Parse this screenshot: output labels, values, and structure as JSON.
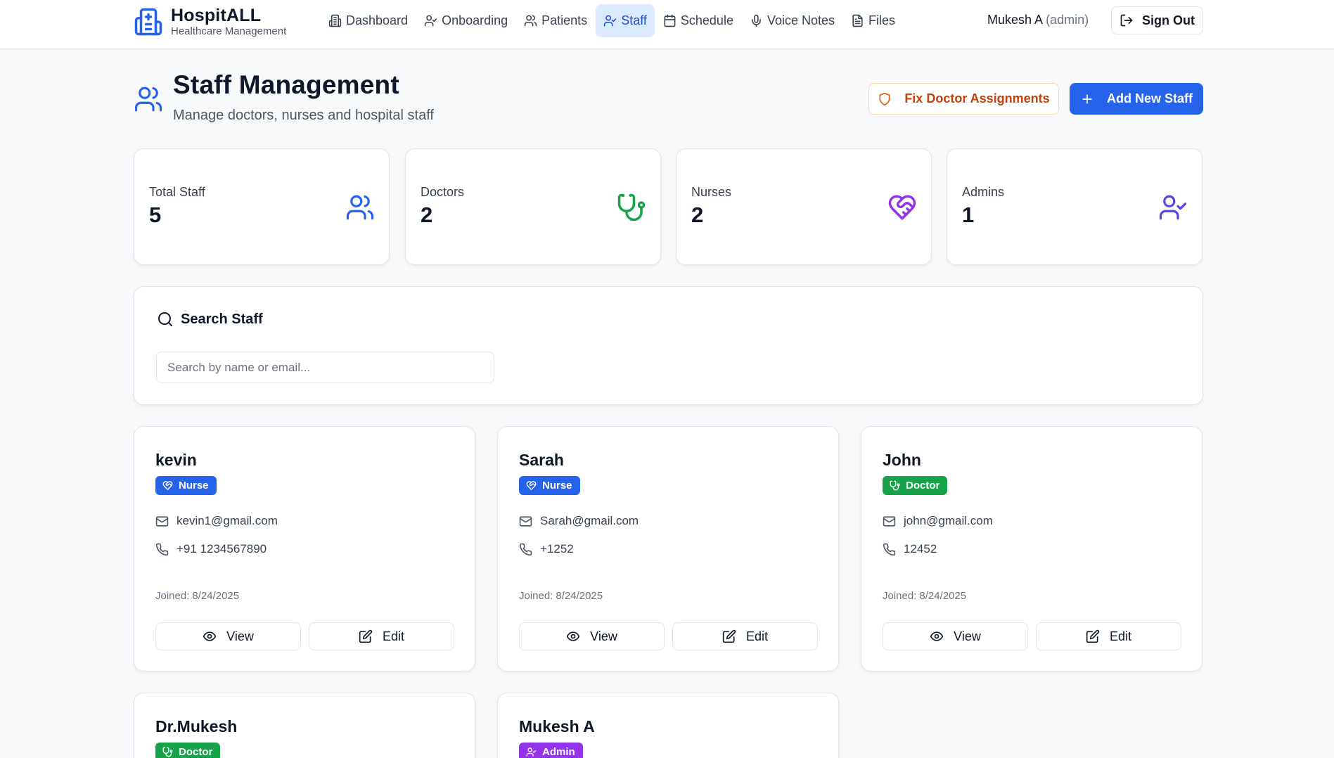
{
  "brand": {
    "title": "HospitALL",
    "subtitle": "Healthcare Management"
  },
  "nav": [
    {
      "label": "Dashboard",
      "icon": "building-icon"
    },
    {
      "label": "Onboarding",
      "icon": "user-check-icon"
    },
    {
      "label": "Patients",
      "icon": "users-icon"
    },
    {
      "label": "Staff",
      "icon": "user-check-icon",
      "active": true
    },
    {
      "label": "Schedule",
      "icon": "calendar-icon"
    },
    {
      "label": "Voice Notes",
      "icon": "mic-icon"
    },
    {
      "label": "Files",
      "icon": "file-icon"
    }
  ],
  "user": {
    "name": "Mukesh A",
    "role": "(admin)"
  },
  "signout_label": "Sign Out",
  "page": {
    "title": "Staff Management",
    "subtitle": "Manage doctors, nurses and hospital staff",
    "fix_label": "Fix Doctor Assignments",
    "add_label": "Add New Staff"
  },
  "stats": [
    {
      "label": "Total Staff",
      "value": "5",
      "icon": "users-icon",
      "color": "#2563eb"
    },
    {
      "label": "Doctors",
      "value": "2",
      "icon": "stethoscope-icon",
      "color": "#16a34a"
    },
    {
      "label": "Nurses",
      "value": "2",
      "icon": "heart-handshake-icon",
      "color": "#9333ea"
    },
    {
      "label": "Admins",
      "value": "1",
      "icon": "user-check-icon",
      "color": "#4f46e5"
    }
  ],
  "search": {
    "title": "Search Staff",
    "placeholder": "Search by name or email..."
  },
  "card_labels": {
    "joined": "Joined:",
    "view": "View",
    "edit": "Edit"
  },
  "staff": [
    {
      "name": "kevin",
      "role": "Nurse",
      "email": "kevin1@gmail.com",
      "phone": "+91 1234567890",
      "joined": "8/24/2025"
    },
    {
      "name": "Sarah",
      "role": "Nurse",
      "email": "Sarah@gmail.com",
      "phone": "+1252",
      "joined": "8/24/2025"
    },
    {
      "name": "John",
      "role": "Doctor",
      "email": "john@gmail.com",
      "phone": "12452",
      "joined": "8/24/2025"
    },
    {
      "name": "Dr.Mukesh",
      "role": "Doctor"
    },
    {
      "name": "Mukesh A",
      "role": "Admin"
    }
  ],
  "colors": {
    "primary": "#2563eb",
    "nurse": "#2563eb",
    "doctor": "#16a34a",
    "admin": "#9333ea",
    "warning": "#c2410c"
  }
}
